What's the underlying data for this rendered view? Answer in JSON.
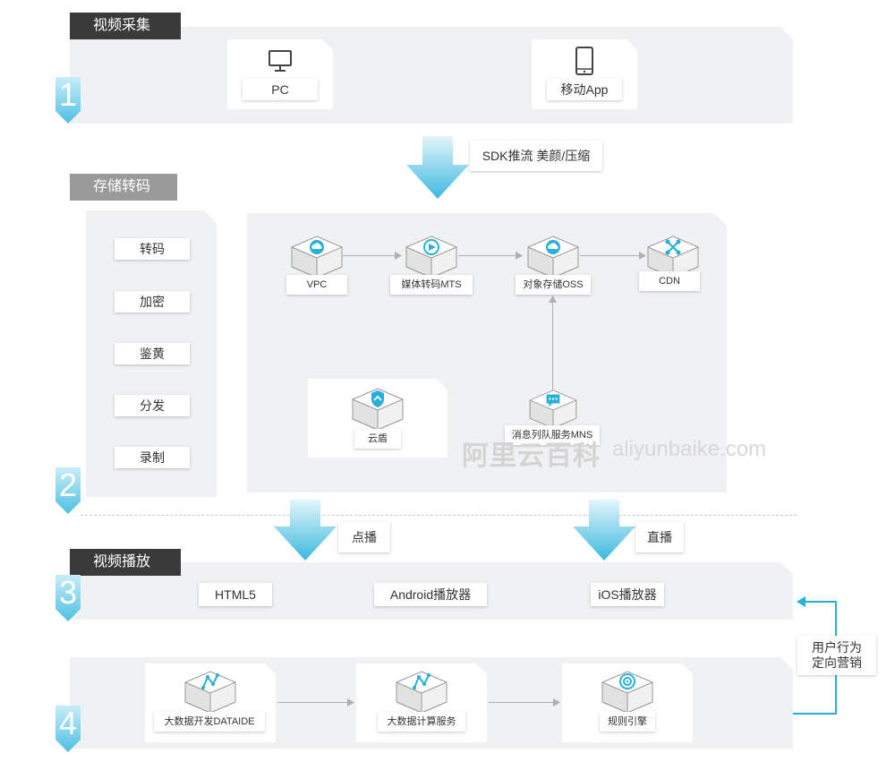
{
  "sections": {
    "capture": "视频采集",
    "storage": "存储转码",
    "playback": "视频播放"
  },
  "numbers": [
    "1",
    "2",
    "3",
    "4"
  ],
  "capture": {
    "pc": "PC",
    "mobile": "移动App"
  },
  "arrow_labels": {
    "sdk": "SDK推流 美颜/压缩",
    "vod": "点播",
    "live": "直播"
  },
  "storage_list": [
    "转码",
    "加密",
    "鉴黄",
    "分发",
    "录制"
  ],
  "storage_nodes": {
    "vpc": "VPC",
    "mts": "媒体转码MTS",
    "oss": "对象存储OSS",
    "cdn": "CDN",
    "shield": "云盾",
    "mns": "消息列队服务MNS"
  },
  "players": [
    "HTML5",
    "Android播放器",
    "iOS播放器"
  ],
  "analytics": {
    "dataide": "大数据开发DATAIDE",
    "compute": "大数据计算服务",
    "rules": "规则引擎"
  },
  "feedback": {
    "line1": "用户行为",
    "line2": "定向营销"
  },
  "watermark": {
    "cn": "阿里云百科",
    "en": "aliyunbaike.com"
  },
  "colors": {
    "accent": "#29b0d9",
    "arrow_light": "#d8f1f9",
    "panel": "#eff1f3"
  }
}
